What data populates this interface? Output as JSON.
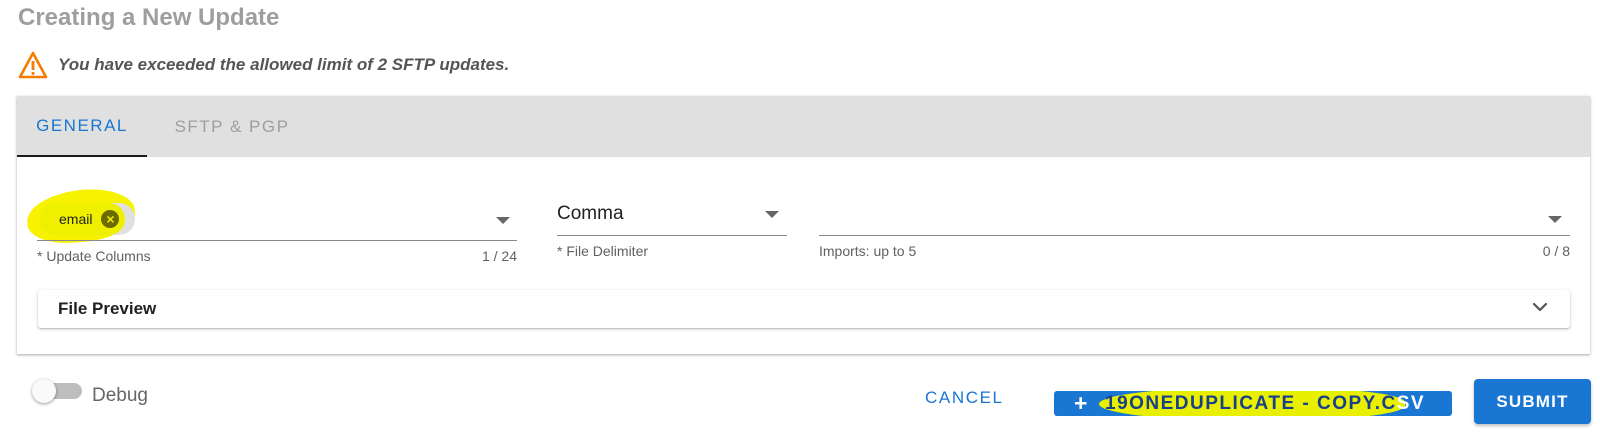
{
  "page_title": "Creating a New Update",
  "warning": {
    "icon": "warning-triangle-icon",
    "icon_color": "#f57c00",
    "text": "You have exceeded the allowed limit of 2 SFTP updates."
  },
  "tabs": [
    {
      "label": "GENERAL",
      "active": true
    },
    {
      "label": "SFTP & PGP",
      "active": false
    }
  ],
  "update_columns": {
    "chips": [
      "email"
    ],
    "label": "* Update Columns",
    "counter": "1 / 24"
  },
  "file_delimiter": {
    "value": "Comma",
    "label": "* File Delimiter"
  },
  "imports": {
    "value": "",
    "label": "Imports: up to 5",
    "counter": "0 / 8"
  },
  "file_preview": {
    "label": "File Preview",
    "expanded": false
  },
  "debug": {
    "label": "Debug",
    "checked": false
  },
  "actions": {
    "cancel_label": "CANCEL",
    "upload_label_highlighted": "19ONEDUPLICATE - COPY.C",
    "upload_label_rest": "SV",
    "submit_label": "SUBMIT"
  },
  "colors": {
    "primary": "#1976d2",
    "highlight": "#f6f200",
    "tab_bar": "#e0e0e0",
    "title": "#9e9e9e"
  }
}
